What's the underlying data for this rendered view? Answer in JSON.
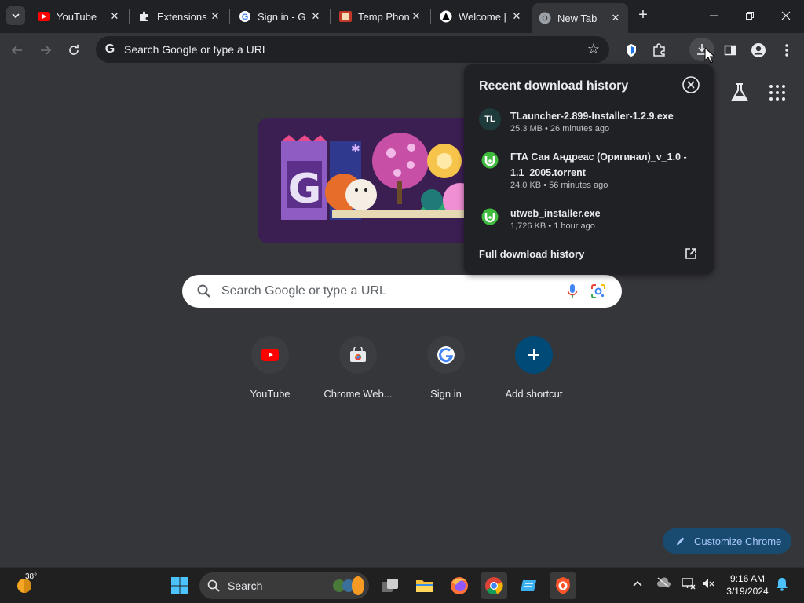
{
  "tabs": [
    {
      "title": "YouTube",
      "favicon": "youtube-icon"
    },
    {
      "title": "Extensions",
      "favicon": "puzzle-icon"
    },
    {
      "title": "Sign in - G",
      "favicon": "google-icon"
    },
    {
      "title": "Temp Phon",
      "favicon": "temp-phone-icon"
    },
    {
      "title": "Welcome |",
      "favicon": "welcome-icon"
    },
    {
      "title": "New Tab",
      "favicon": "chrome-icon",
      "active": true
    }
  ],
  "omnibox": {
    "placeholder": "Search Google or type a URL"
  },
  "search": {
    "placeholder": "Search Google or type a URL"
  },
  "shortcuts": [
    {
      "label": "YouTube",
      "icon": "youtube-icon"
    },
    {
      "label": "Chrome Web...",
      "icon": "chrome-web-store-icon"
    },
    {
      "label": "Sign in",
      "icon": "google-icon"
    },
    {
      "label": "Add shortcut",
      "icon": "plus-icon"
    }
  ],
  "downloads": {
    "title": "Recent download history",
    "items": [
      {
        "name": "TLauncher-2.899-Installer-1.2.9.exe",
        "meta": "25.3 MB • 26 minutes ago",
        "icon_text": "TL"
      },
      {
        "name": "ГТА Сан Андреас (Оригинал)_v_1.0 - 1.1_2005.torrent",
        "meta": "24.0 KB • 56 minutes ago",
        "icon_text": ""
      },
      {
        "name": "utweb_installer.exe",
        "meta": "1,726 KB • 1 hour ago",
        "icon_text": ""
      }
    ],
    "full_history": "Full download history"
  },
  "customize": {
    "label": "Customize Chrome"
  },
  "taskbar": {
    "search_label": "Search",
    "weather_temp": "38°",
    "time": "9:16 AM",
    "date": "3/19/2024"
  },
  "colors": {
    "accent": "#8ab4f8",
    "background": "#35363a",
    "popup": "#202124"
  }
}
